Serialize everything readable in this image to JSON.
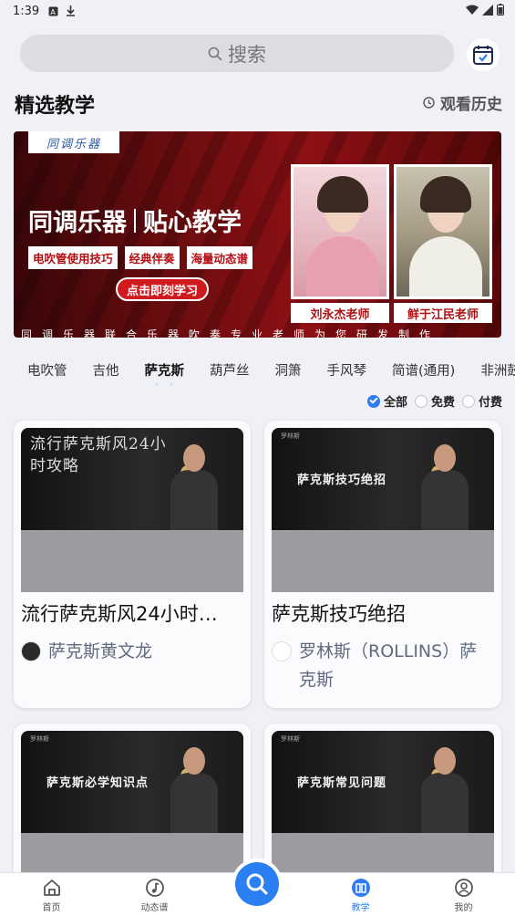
{
  "status_bar": {
    "time": "1:39"
  },
  "search": {
    "placeholder": "搜索"
  },
  "section": {
    "title": "精选教学",
    "history_label": "观看历史"
  },
  "banner": {
    "logo_text": "同调乐器",
    "title_left": "同调乐器",
    "title_right": "贴心教学",
    "tags": [
      "电吹管使用技巧",
      "经典伴奏",
      "海量动态谱"
    ],
    "cta": "点击即刻学习",
    "teachers": [
      "刘永杰老师",
      "鲜于江民老师"
    ],
    "marquee": "同调乐器联合乐器吹奏专业老师为您研发制作"
  },
  "category_tabs": [
    "电吹管",
    "吉他",
    "萨克斯",
    "葫芦丝",
    "洞箫",
    "手风琴",
    "简谱(通用)",
    "非洲鼓"
  ],
  "active_tab": "萨克斯",
  "filters": [
    {
      "label": "全部",
      "selected": true
    },
    {
      "label": "免费",
      "selected": false
    },
    {
      "label": "付费",
      "selected": false
    }
  ],
  "cards": [
    {
      "thumb_caption": "流行萨克斯风24小时攻略",
      "title": "流行萨克斯风24小时…",
      "author": "萨克斯黄文龙"
    },
    {
      "thumb_brand": "罗林斯",
      "thumb_caption": "萨克斯技巧绝招",
      "title": "萨克斯技巧绝招",
      "author": "罗林斯（ROLLINS）萨克斯"
    },
    {
      "thumb_brand": "罗林斯",
      "thumb_caption": "萨克斯必学知识点"
    },
    {
      "thumb_brand": "罗林斯",
      "thumb_caption": "萨克斯常见问题"
    }
  ],
  "bottom_nav": [
    {
      "label": "首页"
    },
    {
      "label": "动态谱"
    },
    {
      "label": "教学"
    },
    {
      "label": "我的"
    }
  ],
  "colors": {
    "accent": "#2f7cf0",
    "banner_red": "#8d1014"
  }
}
